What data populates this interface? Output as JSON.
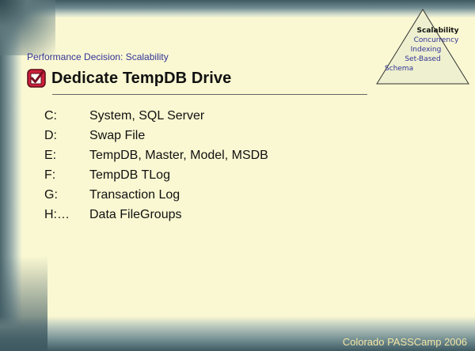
{
  "slide": {
    "subtitle": "Performance Decision: Scalability",
    "title": "Dedicate TempDB Drive",
    "items": [
      {
        "letter": "C:",
        "text": "System, SQL Server"
      },
      {
        "letter": "D:",
        "text": "Swap File"
      },
      {
        "letter": "E:",
        "text": "TempDB, Master, Model, MSDB"
      },
      {
        "letter": "F:",
        "text": "TempDB TLog"
      },
      {
        "letter": "G:",
        "text": "Transaction Log"
      },
      {
        "letter": "H:…",
        "text": "Data FileGroups"
      }
    ],
    "footer": "Colorado PASSCamp 2006"
  },
  "pyramid": {
    "levels": [
      "Scalability",
      "Concurrency",
      "Indexing",
      "Set-Based",
      "Schema"
    ]
  },
  "colors": {
    "accent": "#333399",
    "background": "#faf8d2",
    "checkbox": "#cc1f3a",
    "footer": "#f3e6a6"
  },
  "icons": {
    "title_icon": "checkbox-icon"
  }
}
